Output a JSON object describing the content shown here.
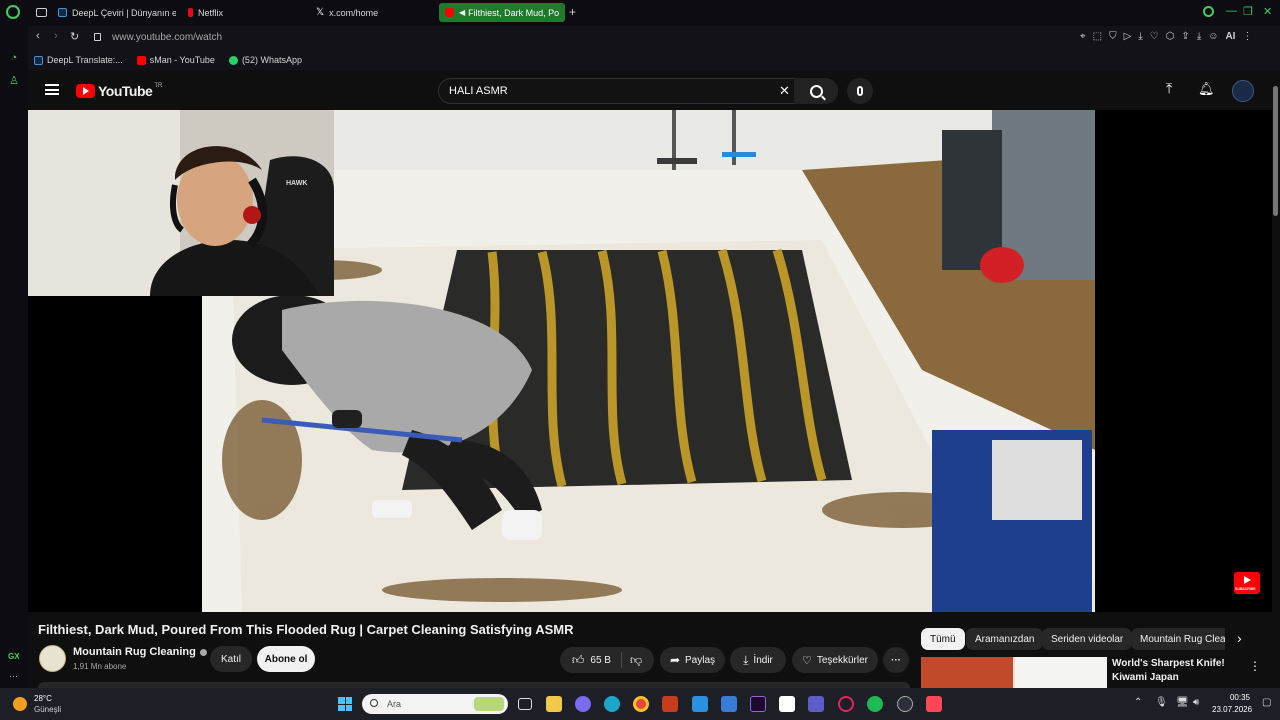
{
  "browser": {
    "tabs": [
      {
        "label": "DeepL Çeviri | Dünyanın en",
        "color": "#0f2b46"
      },
      {
        "label": "Netflix",
        "color": "#e50914"
      },
      {
        "label": "x.com/home",
        "color": "#000000"
      },
      {
        "label": "Filthiest, Dark Mud, Po",
        "color": "#ff0000",
        "active": true
      }
    ],
    "new_tab": "+",
    "url": "www.youtube.com/watch",
    "ai_label": "AI",
    "bookmarks": [
      {
        "label": "DeepL Translate:...",
        "color": "#0f2b46"
      },
      {
        "label": "sMan - YouTube",
        "color": "#ff0000"
      },
      {
        "label": "(52) WhatsApp",
        "color": "#25d366"
      }
    ],
    "sidebar_label": "GX",
    "sidebar_more": "···"
  },
  "youtube": {
    "logo_text": "YouTube",
    "logo_region": "TR",
    "search_query": "HALI ASMR",
    "video": {
      "title": "Filthiest, Dark Mud, Poured From This Flooded Rug | Carpet Cleaning Satisfying ASMR",
      "watermark_label": "SUBSCRIBE"
    },
    "channel": {
      "name": "Mountain Rug Cleaning",
      "subscribers": "1,91 Mn abone",
      "join_label": "Katıl",
      "subscribe_label": "Abone ol"
    },
    "actions": {
      "likes": "65 B",
      "share": "Paylaş",
      "download": "İndir",
      "thanks": "Teşekkürler",
      "more": "···"
    },
    "chips": [
      "Tümü",
      "Aramanızdan",
      "Seriden videolar",
      "Mountain Rug Clea"
    ],
    "recommendation": {
      "title": "World's Sharpest Knife! Kiwami Japan"
    }
  },
  "webcam_overlay": {
    "chair_brand": "HAWK"
  },
  "taskbar": {
    "weather_temp": "28°C",
    "weather_desc": "Güneşli",
    "search_placeholder": "Ara",
    "time": "00:35",
    "date": "23.07.2026"
  }
}
